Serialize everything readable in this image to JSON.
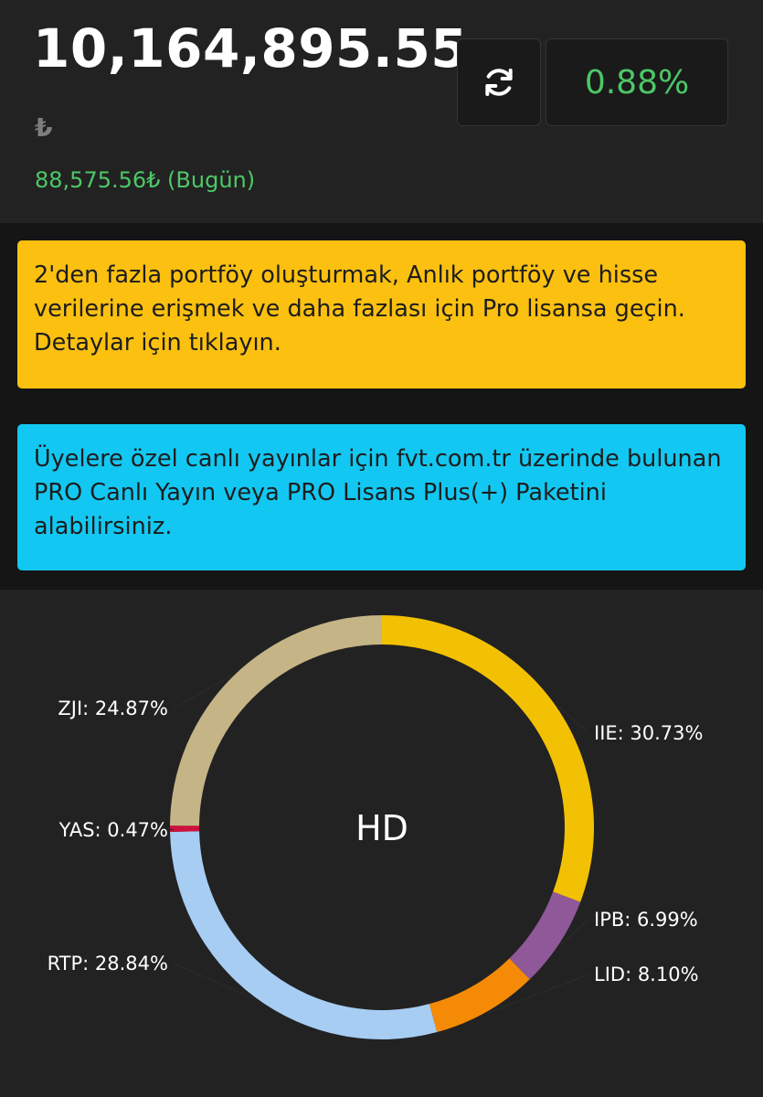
{
  "portfolio": {
    "total_value": "10,164,895.55",
    "currency_symbol": "₺",
    "daily_change": "88,575.56₺ (Bugün)",
    "change_percent": "0.88%"
  },
  "icons": {
    "refresh": "refresh-icon"
  },
  "banners": {
    "pro_license": "2'den fazla portföy oluşturmak, Anlık portföy ve hisse verilerine erişmek ve daha fazlası için Pro lisansa geçin. Detaylar için tıklayın.",
    "live_stream": "Üyelere özel canlı yayınlar için fvt.com.tr üzerinde bulunan PRO Canlı Yayın veya PRO Lisans Plus(+) Paketini alabilirsiniz."
  },
  "colors": {
    "positive": "#4cc866",
    "pro_banner": "#fbc010",
    "live_banner": "#12c8f2"
  },
  "chart_data": {
    "type": "pie",
    "center_label": "HD",
    "series": [
      {
        "label": "IIE",
        "value": 30.73,
        "display": "IIE: 30.73%",
        "color": "#f3c103"
      },
      {
        "label": "IPB",
        "value": 6.99,
        "display": "IPB: 6.99%",
        "color": "#8e5899"
      },
      {
        "label": "LID",
        "value": 8.1,
        "display": "LID: 8.10%",
        "color": "#f58a06"
      },
      {
        "label": "RTP",
        "value": 28.84,
        "display": "RTP: 28.84%",
        "color": "#a7cdf3"
      },
      {
        "label": "YAS",
        "value": 0.47,
        "display": "YAS: 0.47%",
        "color": "#d0113c"
      },
      {
        "label": "ZJI",
        "value": 24.87,
        "display": "ZJI: 24.87%",
        "color": "#c5b486"
      }
    ]
  }
}
